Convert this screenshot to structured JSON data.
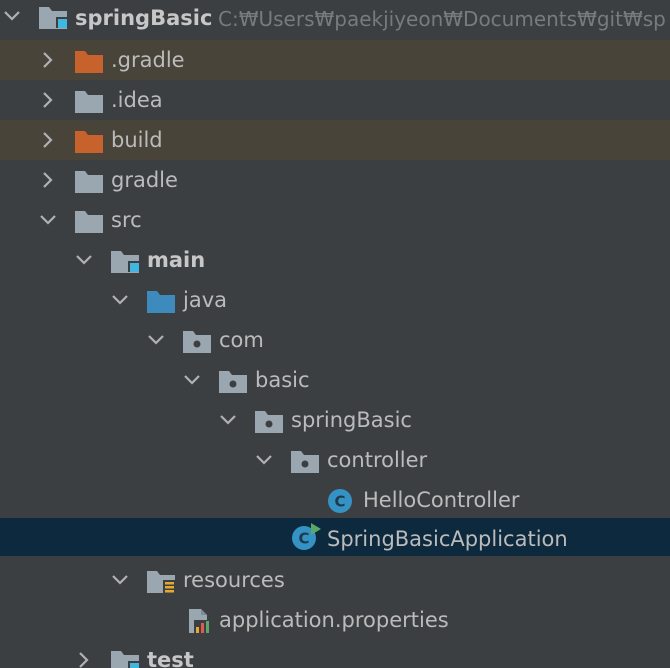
{
  "project": {
    "name": "springBasic",
    "path": "C:₩Users₩paekjiyeon₩Documents₩git₩sp"
  },
  "tree": {
    "gradle_hidden": ".gradle",
    "idea": ".idea",
    "build": "build",
    "gradle": "gradle",
    "src": "src",
    "main": "main",
    "java": "java",
    "com": "com",
    "basic": "basic",
    "springBasic": "springBasic",
    "controller": "controller",
    "helloController": "HelloController",
    "springBasicApplication": "SpringBasicApplication",
    "resources": "resources",
    "applicationProperties": "application.properties",
    "test": "test"
  },
  "colors": {
    "background": "#3c3f41",
    "excluded_row": "#49443a",
    "selected_row": "#0d293e",
    "folder": "#9aa7b0",
    "excluded_folder": "#c7622c",
    "source_folder": "#3d8bbd",
    "class_icon": "#3592c4",
    "module_marker": "#40b6e0",
    "run_marker": "#59a869"
  }
}
